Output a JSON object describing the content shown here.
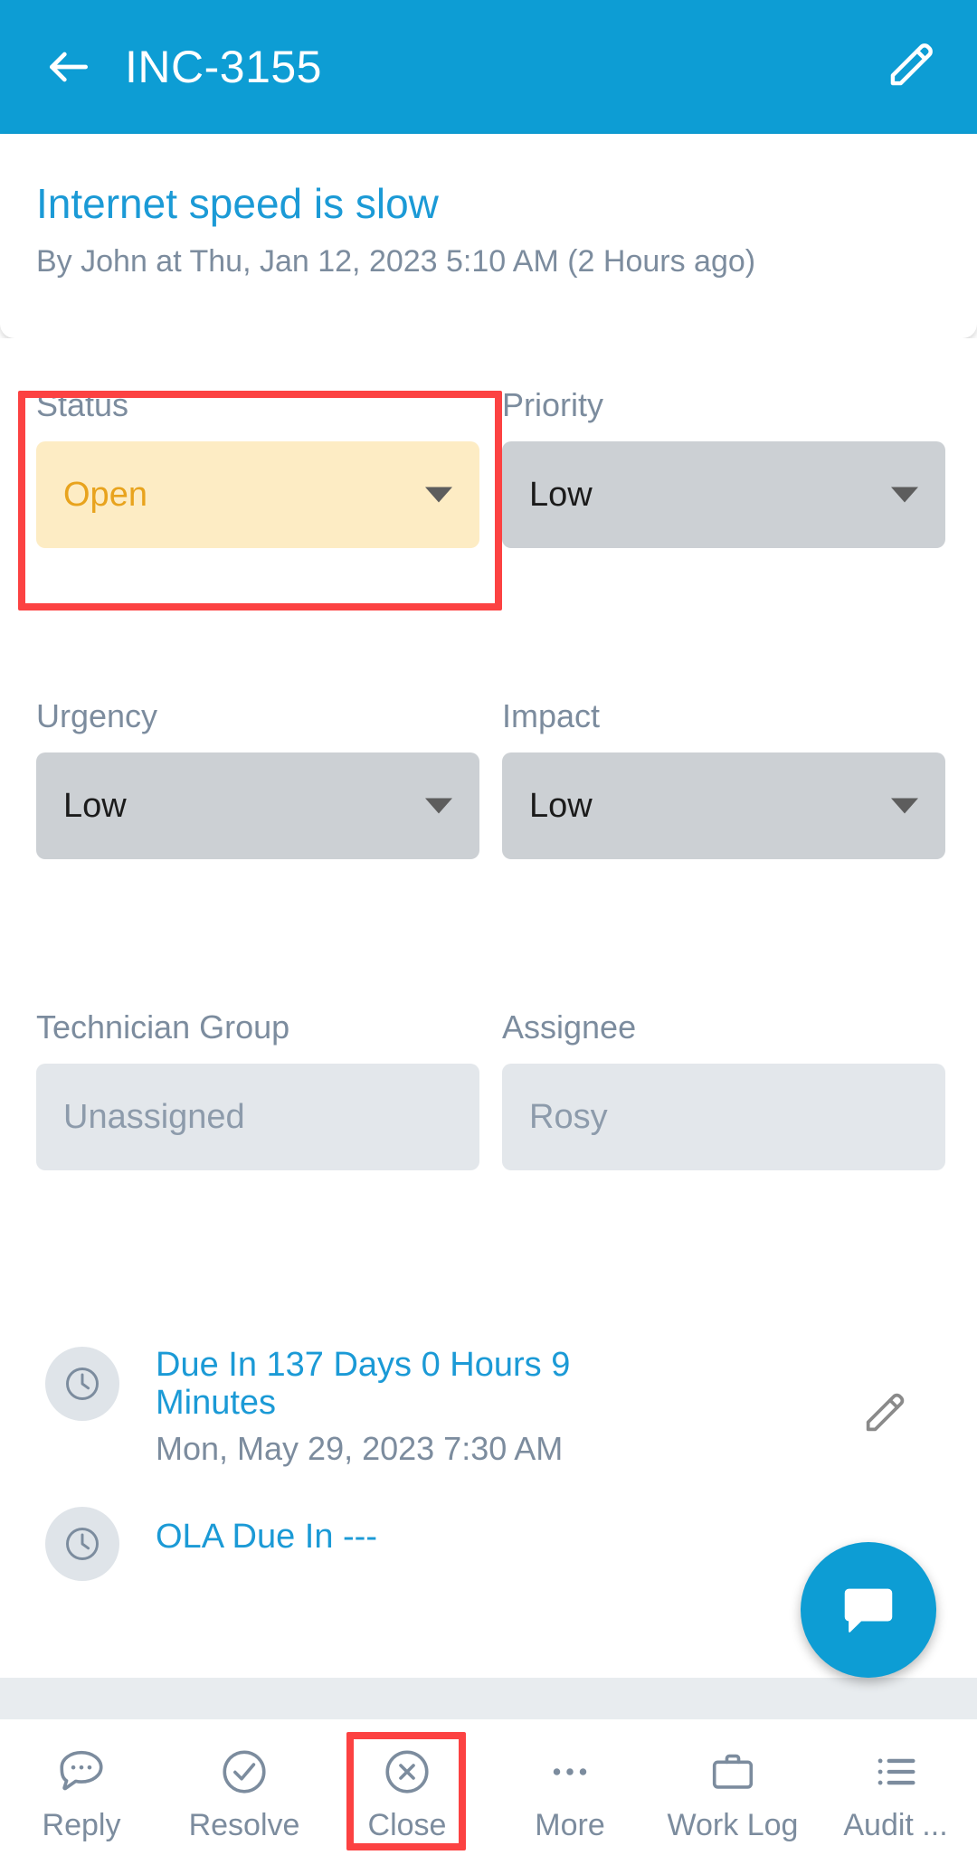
{
  "header": {
    "back_icon": "arrow-left-icon",
    "title": "INC-3155",
    "edit_icon": "pencil-icon",
    "background_color": "#0d9dd4"
  },
  "ticket": {
    "title": "Internet speed is slow",
    "meta": "By John at Thu, Jan 12, 2023 5:10 AM (2 Hours ago)",
    "title_color": "#1b9ad6",
    "meta_color": "#7c8c9e"
  },
  "fields": [
    {
      "label": "Status",
      "value": "Open",
      "style": "yellow",
      "caret": true,
      "highlighted": true
    },
    {
      "label": "Priority",
      "value": "Low",
      "style": "grey",
      "caret": true,
      "highlighted": false
    },
    {
      "label": "Urgency",
      "value": "Low",
      "style": "grey",
      "caret": true,
      "highlighted": false
    },
    {
      "label": "Impact",
      "value": "Low",
      "style": "grey",
      "caret": true,
      "highlighted": false
    },
    {
      "label": "Technician Group",
      "value": "Unassigned",
      "style": "disabled",
      "caret": false,
      "highlighted": false
    },
    {
      "label": "Assignee",
      "value": "Rosy",
      "style": "disabled",
      "caret": false,
      "highlighted": false
    }
  ],
  "sla": [
    {
      "icon": "clock-icon",
      "primary": "Due In 137 Days 0 Hours 9 Minutes",
      "secondary": "Mon, May 29, 2023 7:30 AM",
      "edit_icon": "pencil-icon"
    },
    {
      "icon": "clock-icon",
      "primary": "OLA Due In ---",
      "secondary": ""
    }
  ],
  "fab": {
    "icon": "chat-bubble-icon",
    "color": "#0d9dd4"
  },
  "toolbar": {
    "items": [
      {
        "label": "Reply",
        "icon": "chat-dots-icon"
      },
      {
        "label": "Resolve",
        "icon": "check-circle-icon"
      },
      {
        "label": "Close",
        "icon": "x-circle-icon"
      },
      {
        "label": "More",
        "icon": "ellipsis-icon"
      },
      {
        "label": "Work Log",
        "icon": "briefcase-icon"
      },
      {
        "label": "Audit ...",
        "icon": "list-icon"
      }
    ],
    "highlighted_index": 2
  },
  "annotation": {
    "color": "#fc4242"
  },
  "colors": {
    "accent": "#0d9dd4",
    "link": "#1b9ad6",
    "muted": "#7c8c9e",
    "field_grey": "#ccd0d4",
    "field_yellow": "#fdecc4",
    "field_disabled": "#e3e7eb",
    "status_text": "#e8a31d",
    "strip_grey": "#e8ecef"
  }
}
